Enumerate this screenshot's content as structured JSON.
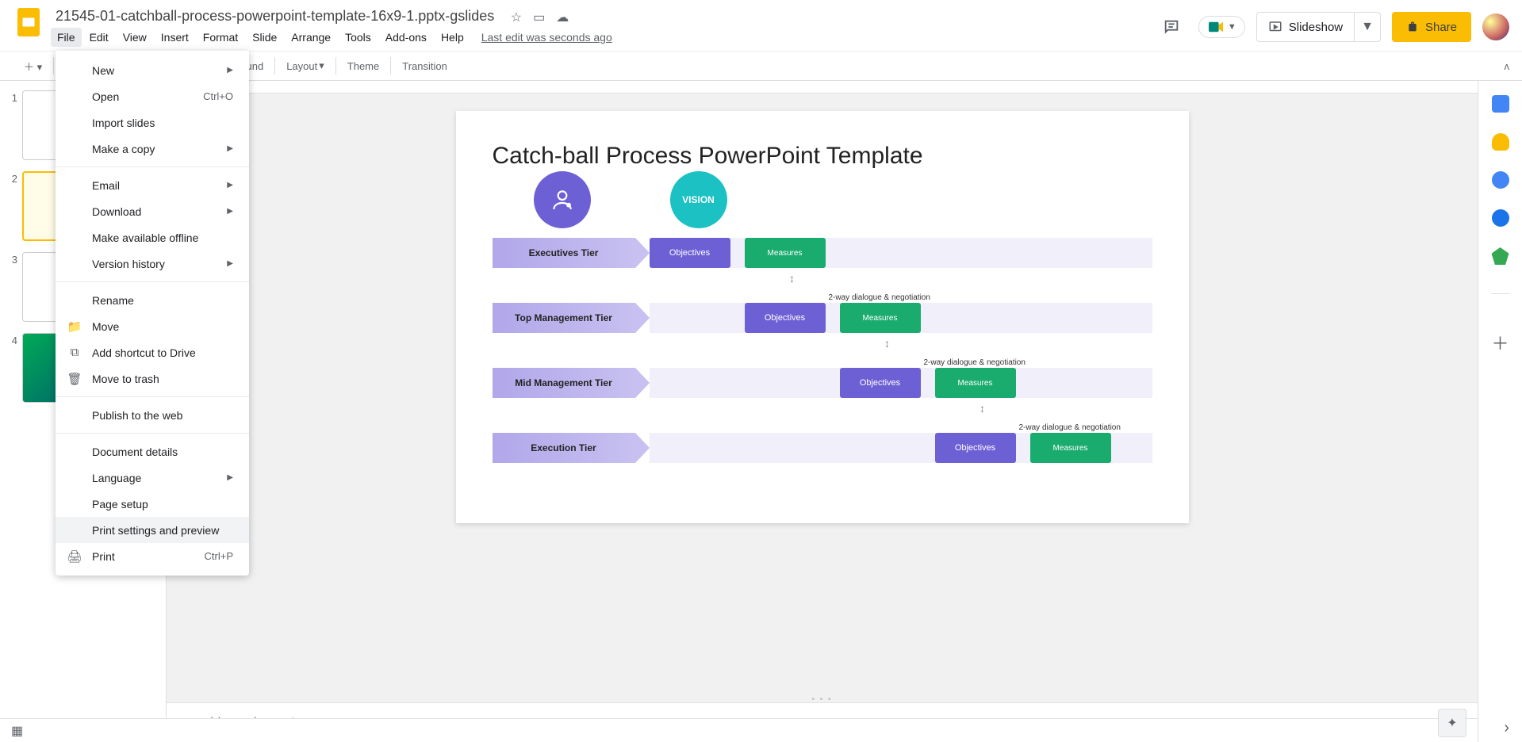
{
  "doc_title": "21545-01-catchball-process-powerpoint-template-16x9-1.pptx-gslides",
  "menubar": [
    "File",
    "Edit",
    "View",
    "Insert",
    "Format",
    "Slide",
    "Arrange",
    "Tools",
    "Add-ons",
    "Help"
  ],
  "last_edit": "Last edit was seconds ago",
  "header": {
    "slideshow": "Slideshow",
    "share": "Share"
  },
  "toolbar": {
    "background": "Background",
    "layout": "Layout",
    "theme": "Theme",
    "transition": "Transition"
  },
  "file_menu": {
    "new": "New",
    "open": "Open",
    "open_sc": "Ctrl+O",
    "import": "Import slides",
    "copy": "Make a copy",
    "email": "Email",
    "download": "Download",
    "offline": "Make available offline",
    "version": "Version history",
    "rename": "Rename",
    "move": "Move",
    "shortcut": "Add shortcut to Drive",
    "trash": "Move to trash",
    "publish": "Publish to the web",
    "details": "Document details",
    "language": "Language",
    "pagesetup": "Page setup",
    "printprev": "Print settings and preview",
    "print": "Print",
    "print_sc": "Ctrl+P"
  },
  "slide": {
    "title": "Catch-ball Process PowerPoint Template",
    "vision": "VISION",
    "tiers": [
      "Executives Tier",
      "Top Management Tier",
      "Mid Management Tier",
      "Execution Tier"
    ],
    "objectives": "Objectives",
    "measures": "Measures",
    "dialogue": "2-way dialogue & negotiation"
  },
  "speaker_notes_placeholder": "add speaker notes",
  "thumbs": [
    "1",
    "2",
    "3",
    "4"
  ]
}
